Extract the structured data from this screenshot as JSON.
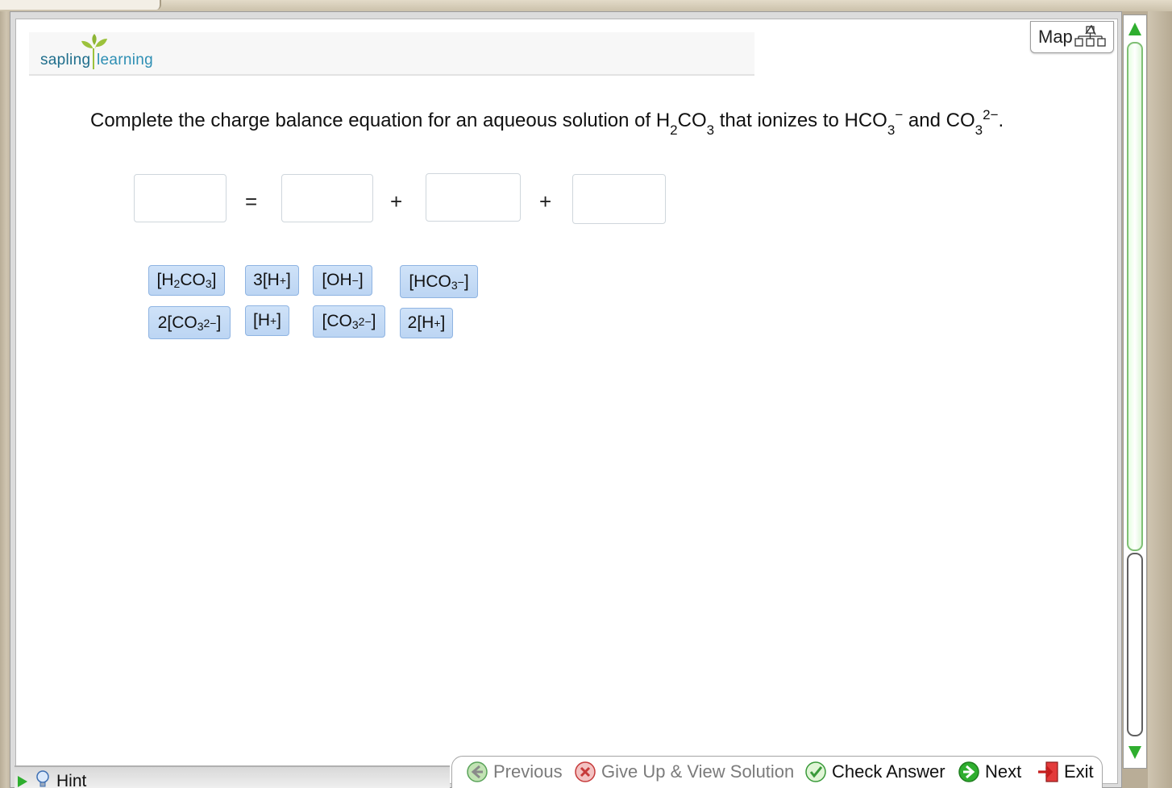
{
  "header": {
    "logo_left": "sapling",
    "logo_right": "learning",
    "map_label": "Map"
  },
  "question": {
    "prefix": "Complete the charge balance equation for an aqueous solution of H",
    "s1": "2",
    "t1": "CO",
    "s2": "3",
    "t2": " that ionizes to HCO",
    "s3": "3",
    "sup3": "−",
    "t3": " and CO",
    "s4": "3",
    "sup4": "2−",
    "t4": "."
  },
  "equation": {
    "equals": "=",
    "plus1": "+",
    "plus2": "+"
  },
  "tiles": [
    {
      "pre": "[H",
      "sub": "2",
      "mid": "CO",
      "sub2": "3",
      "sup": "",
      "post": "]"
    },
    {
      "pre": "3[H",
      "sub": "",
      "mid": "",
      "sub2": "",
      "sup": "+",
      "post": "]"
    },
    {
      "pre": "[OH",
      "sub": "",
      "mid": "",
      "sub2": "",
      "sup": "−",
      "post": "]"
    },
    {
      "pre": "[HCO",
      "sub": "",
      "mid": "",
      "sub2": "3",
      "sup": "−",
      "post": "]"
    },
    {
      "pre": "2[CO",
      "sub": "",
      "mid": "",
      "sub2": "3",
      "sup": "2−",
      "post": "]"
    },
    {
      "pre": "[H",
      "sub": "",
      "mid": "",
      "sub2": "",
      "sup": "+",
      "post": "]"
    },
    {
      "pre": "[CO",
      "sub": "",
      "mid": "",
      "sub2": "3",
      "sup": "2−",
      "post": "]"
    },
    {
      "pre": "2[H",
      "sub": "",
      "mid": "",
      "sub2": "",
      "sup": "+",
      "post": "]"
    }
  ],
  "footer": {
    "hint": "Hint",
    "previous": "Previous",
    "give_up": "Give Up & View Solution",
    "check": "Check Answer",
    "next": "Next",
    "exit": "Exit"
  },
  "colors": {
    "accent_green": "#2fae2f",
    "tile_blue": "#c6dbf5",
    "logo_blue": "#2e8fb4"
  }
}
